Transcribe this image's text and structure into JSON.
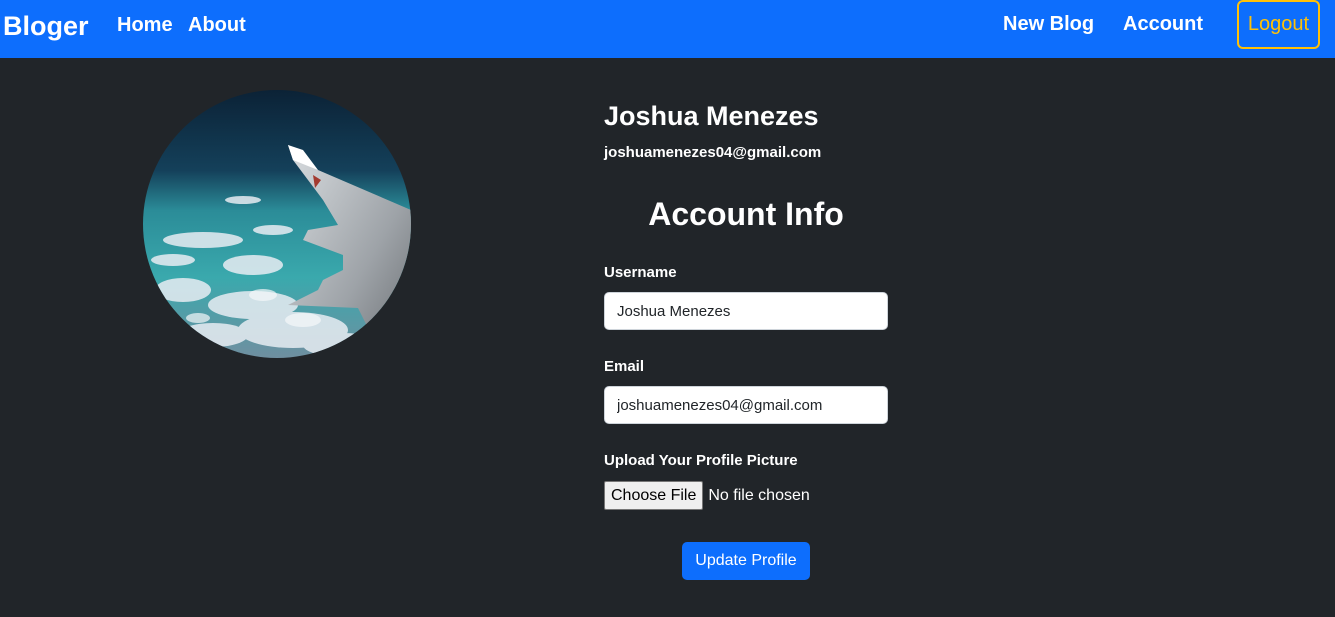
{
  "navbar": {
    "brand": "Bloger",
    "left_links": [
      {
        "label": "Home"
      },
      {
        "label": "About"
      }
    ],
    "right_links": [
      {
        "label": "New Blog"
      },
      {
        "label": "Account"
      }
    ],
    "logout_label": "Logout"
  },
  "profile": {
    "name": "Joshua Menezes",
    "email": "joshuamenezes04@gmail.com",
    "avatar_icon": "profile-photo-airplane-wing"
  },
  "form": {
    "title": "Account Info",
    "username_label": "Username",
    "username_value": "Joshua Menezes",
    "email_label": "Email",
    "email_value": "joshuamenezes04@gmail.com",
    "upload_label": "Upload Your Profile Picture",
    "file_button_label": "Choose File",
    "file_status": "No file chosen",
    "submit_label": "Update Profile"
  },
  "colors": {
    "primary": "#0d6efd",
    "background": "#212529",
    "warning": "#ffc107"
  }
}
